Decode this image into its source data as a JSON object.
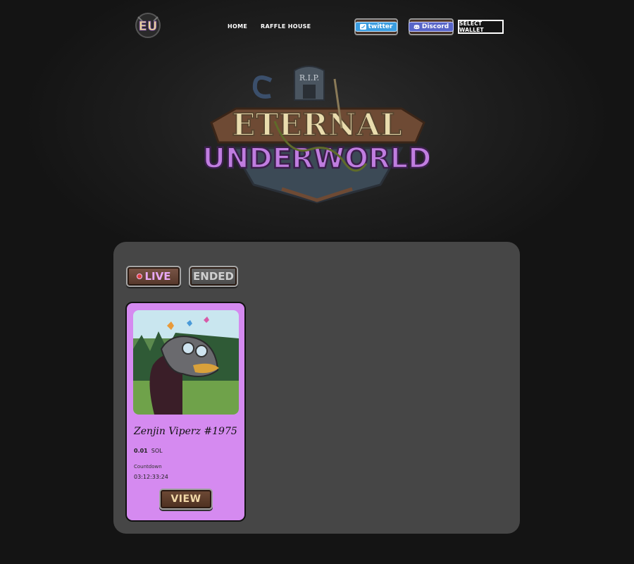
{
  "nav": {
    "logo_text": "EU",
    "links": [
      "HOME",
      "RAFFLE HOUSE"
    ],
    "twitter_label": "twitter",
    "discord_label": "Discord",
    "wallet_label": "SELECT WALLET"
  },
  "hero": {
    "title_top": "ETERNAL",
    "title_bottom": "UNDERWORLD",
    "tombstone_text": "R.I.P."
  },
  "tabs": {
    "live_label": "LIVE",
    "ended_label": "ENDED"
  },
  "raffles": [
    {
      "title": "Zenjin Viperz #1975",
      "price_value": "0.01",
      "price_unit": "SOL",
      "countdown_label": "Countdown",
      "countdown_value": "03:12:33:24",
      "view_label": "VIEW"
    }
  ],
  "colors": {
    "background": "#141414",
    "panel": "#464646",
    "card": "#d58af0",
    "live_text": "#e8a8f5",
    "twitter": "#3a9de0",
    "discord": "#5865c8"
  }
}
